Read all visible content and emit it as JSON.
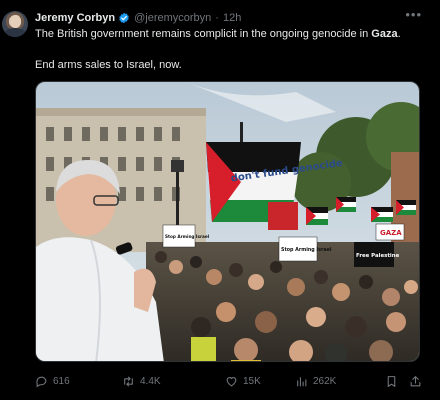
{
  "post": {
    "author_name": "Jeremy Corbyn",
    "handle": "@jeremycorbyn",
    "separator": "·",
    "time": "12h",
    "text_line1_prefix": "The British government remains complicit in the ongoing genocide in ",
    "text_line1_bold": "Gaza",
    "text_line1_suffix": ".",
    "text_line2": "End arms sales to Israel, now."
  },
  "image_text": {
    "flag_lettering": "don't fund genocide",
    "sign_left": "Stop Arming Israel",
    "sign_mid": "Stop Arming Israel",
    "sign_free": "Free Palestine",
    "sign_gaza": "GAZA"
  },
  "stats": {
    "replies": "616",
    "reposts": "4.4K",
    "likes": "15K",
    "views": "262K"
  },
  "icons": {
    "verified": "verified-badge-icon",
    "more": "more-icon",
    "reply": "reply-icon",
    "repost": "repost-icon",
    "like": "like-icon",
    "views": "views-icon",
    "bookmark": "bookmark-icon",
    "share": "share-icon"
  },
  "colors": {
    "background": "#000000",
    "text": "#e7e9ea",
    "muted": "#71767b",
    "verified": "#1d9bf0"
  }
}
